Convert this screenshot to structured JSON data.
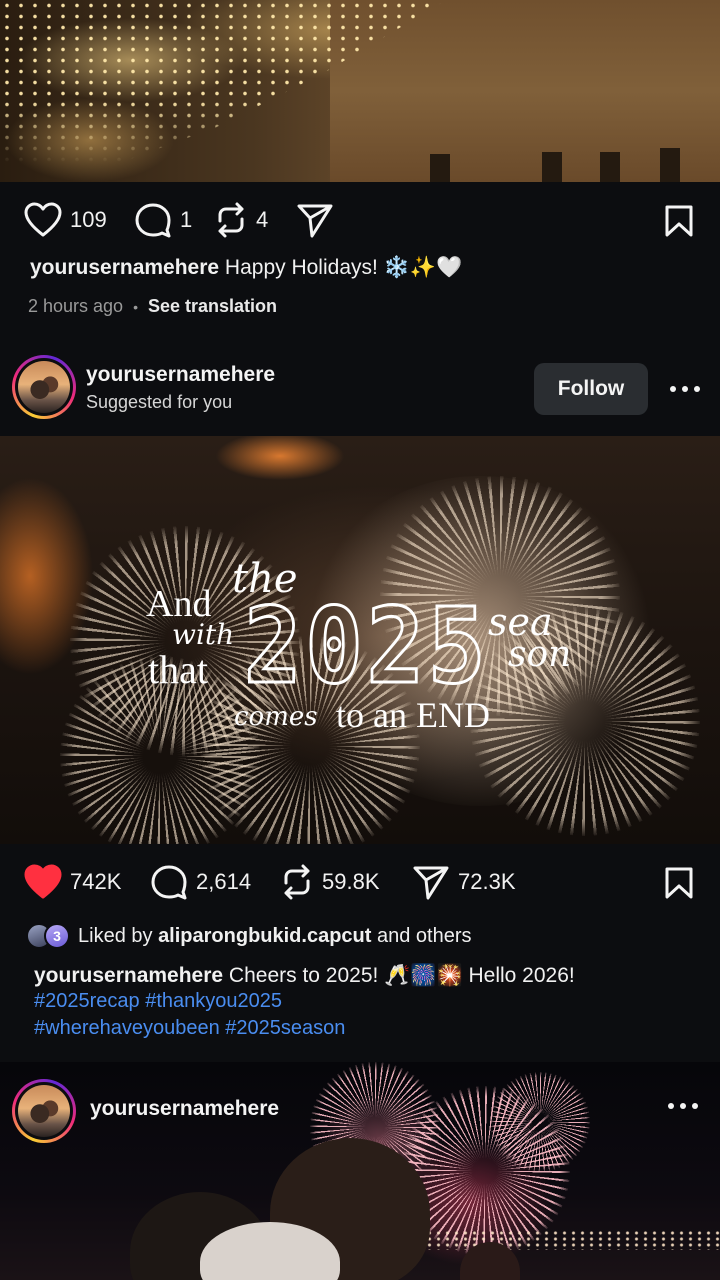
{
  "colors": {
    "background": "#0c0d10",
    "liked_heart": "#ff3040",
    "hashtag": "#4a8df0",
    "follow_button_bg": "#2a2d31"
  },
  "post1": {
    "image_alt": "",
    "actions": {
      "likes": "109",
      "comments": "1",
      "reposts": "4",
      "liked": false
    },
    "caption": {
      "username": "yourusernamehere",
      "text": " Happy Holidays! ❄️✨🤍"
    },
    "timestamp": "2 hours ago",
    "see_translation": "See translation"
  },
  "post2": {
    "header": {
      "username": "yourusernamehere",
      "subtitle": "Suggested for you",
      "follow_label": "Follow"
    },
    "image_text": {
      "and": "And",
      "with": "with",
      "that": "that",
      "the": "the",
      "year": "2025",
      "sea": "sea",
      "son": "son",
      "comes": "comes",
      "to_an_end": "to an END"
    },
    "actions": {
      "likes": "742K",
      "comments": "2,614",
      "reposts": "59.8K",
      "shares": "72.3K",
      "liked": true
    },
    "liked_by": {
      "prefix": "Liked by ",
      "user": "aliparongbukid.capcut",
      "suffix": " and others"
    },
    "caption": {
      "username": "yourusernamehere",
      "text": " Cheers to 2025! 🥂🎆🎇 Hello 2026!",
      "hashtags_line1": "#2025recap #thankyou2025",
      "hashtags_line2": "#wherehaveyoubeen #2025season"
    }
  },
  "post3": {
    "header": {
      "username": "yourusernamehere"
    }
  },
  "icons": {
    "heart": "heart-icon",
    "comment": "comment-icon",
    "repost": "repost-icon",
    "share": "send-icon",
    "bookmark": "bookmark-icon",
    "more": "more-icon"
  }
}
